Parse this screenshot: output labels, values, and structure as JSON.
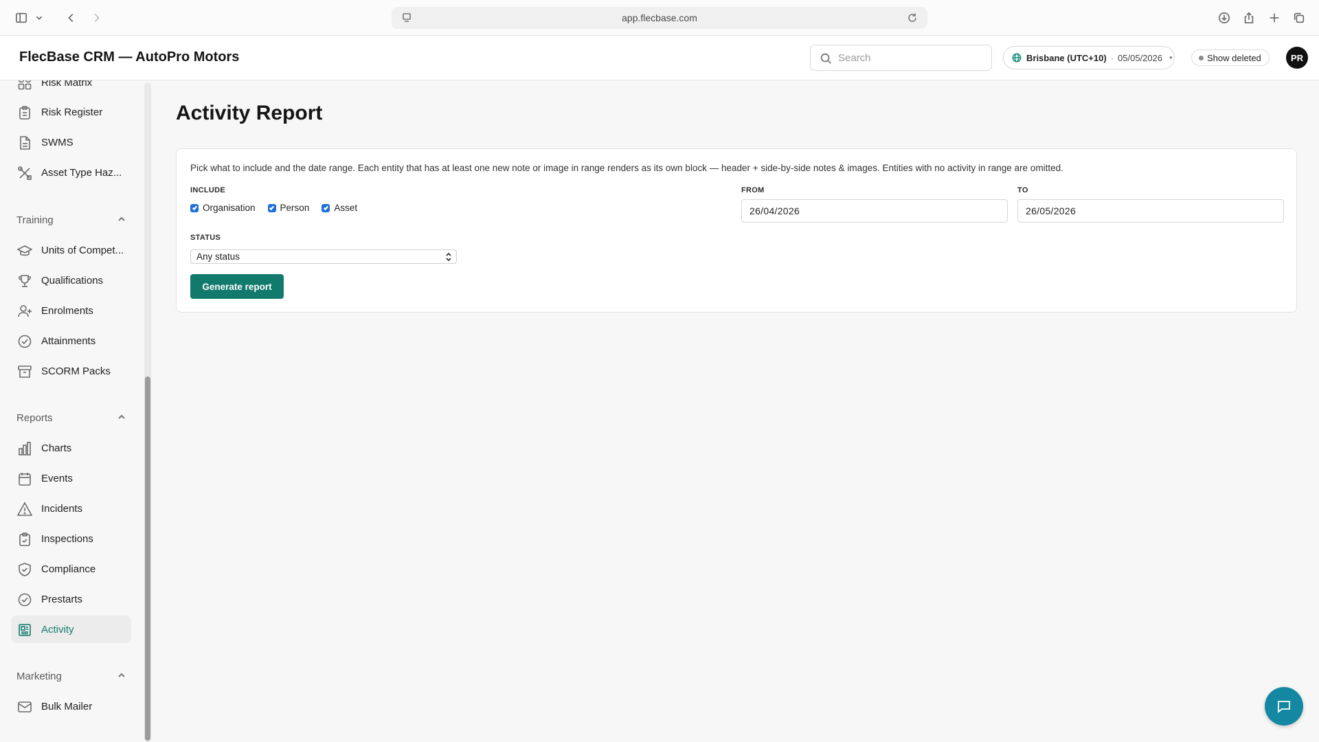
{
  "browser": {
    "url": "app.flecbase.com"
  },
  "header": {
    "title": "FlecBase CRM — AutoPro Motors",
    "search_placeholder": "Search",
    "timezone": "Brisbane (UTC+10)",
    "separator": "·",
    "date": "05/05/2026",
    "show_deleted": "Show deleted",
    "avatar_initials": "PR"
  },
  "sidebar": {
    "items_top": [
      {
        "label": "Risk Matrix",
        "icon": "grid-icon"
      },
      {
        "label": "Risk Register",
        "icon": "clipboard-icon"
      },
      {
        "label": "SWMS",
        "icon": "document-icon"
      },
      {
        "label": "Asset Type Haz...",
        "icon": "tools-icon"
      }
    ],
    "training": {
      "label": "Training",
      "items": [
        {
          "label": "Units of Compet...",
          "icon": "graduation-cap-icon"
        },
        {
          "label": "Qualifications",
          "icon": "trophy-icon"
        },
        {
          "label": "Enrolments",
          "icon": "user-plus-icon"
        },
        {
          "label": "Attainments",
          "icon": "check-circle-icon"
        },
        {
          "label": "SCORM Packs",
          "icon": "archive-icon"
        }
      ]
    },
    "reports": {
      "label": "Reports",
      "items": [
        {
          "label": "Charts",
          "icon": "bar-chart-icon"
        },
        {
          "label": "Events",
          "icon": "calendar-icon"
        },
        {
          "label": "Incidents",
          "icon": "warning-icon"
        },
        {
          "label": "Inspections",
          "icon": "clipboard-check-icon"
        },
        {
          "label": "Compliance",
          "icon": "shield-check-icon"
        },
        {
          "label": "Prestarts",
          "icon": "check-circle-icon"
        },
        {
          "label": "Activity",
          "icon": "newspaper-icon"
        }
      ]
    },
    "marketing": {
      "label": "Marketing",
      "items": [
        {
          "label": "Bulk Mailer",
          "icon": "mail-icon"
        }
      ]
    }
  },
  "main": {
    "title": "Activity Report",
    "description": "Pick what to include and the date range. Each entity that has at least one new note or image in range renders as its own block — header + side-by-side notes & images. Entities with no activity in range are omitted.",
    "include_label": "INCLUDE",
    "include_options": [
      "Organisation",
      "Person",
      "Asset"
    ],
    "from_label": "FROM",
    "from_value": "26/04/2026",
    "to_label": "TO",
    "to_value": "26/05/2026",
    "status_label": "STATUS",
    "status_value": "Any status",
    "generate_button": "Generate report"
  },
  "colors": {
    "accent": "#127a6c",
    "checkbox": "#1e6fd9",
    "chat_fab": "#1487a2"
  }
}
